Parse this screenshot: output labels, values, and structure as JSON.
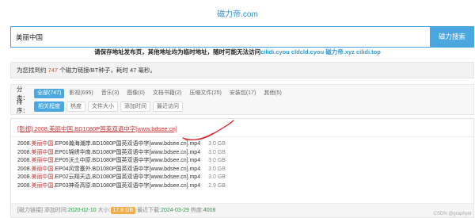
{
  "header": {
    "site_name": "磁力帝.com"
  },
  "search": {
    "value": "美丽中国",
    "button_label": "磁力搜索"
  },
  "notice": {
    "text": "请保存地址发布页，其他地址均为临时地址，随时可能无法访问",
    "mirrors": "cilidi.cyou cldcld.cyou 磁力帝.xyz cilidi.top"
  },
  "result_summary": {
    "prefix": "为您找到约",
    "count": "747",
    "suffix": "个磁力链接/BT种子，耗时 47 毫秒。"
  },
  "filters": {
    "category_label": "分类：",
    "categories": [
      {
        "label": "全部(747)",
        "active": true
      },
      {
        "label": "影视(695)",
        "active": false
      },
      {
        "label": "音乐(3)",
        "active": false
      },
      {
        "label": "图像(0)",
        "active": false
      },
      {
        "label": "文档书籍(2)",
        "active": false
      },
      {
        "label": "压缩文件(25)",
        "active": false
      },
      {
        "label": "安装包(17)",
        "active": false
      },
      {
        "label": "其他(5)",
        "active": false
      }
    ],
    "sort_label": "排序：",
    "sorts": [
      {
        "label": "相关程度",
        "active": true
      },
      {
        "label": "热度",
        "active": false
      },
      {
        "label": "文件大小",
        "active": false
      },
      {
        "label": "添加时间",
        "active": false
      },
      {
        "label": "最近访问",
        "active": false
      }
    ]
  },
  "result": {
    "title_prefix": "[影视] 2008.",
    "title_highlight": "美丽中国",
    "title_suffix": ".BD1080P国英双语中字[www.bdsee.cn]",
    "files": [
      {
        "prefix": "2008.",
        "highlight": "美丽中国",
        "suffix": ".EP06瀚海潮岸.BD1080P国英双语中字[www.bdsee.cn].mp4",
        "size": "3.0 GB"
      },
      {
        "prefix": "2008.",
        "highlight": "美丽中国",
        "suffix": ".EP01锦绣华南.BD1080P国英双语中字[www.bdsee.cn].mp4",
        "size": "3.0 GB"
      },
      {
        "prefix": "2008.",
        "highlight": "美丽中国",
        "suffix": ".EP05沃土中原.BD1080P国英双语中字[www.bdsee.cn].mp4",
        "size": "3.0 GB"
      },
      {
        "prefix": "2008.",
        "highlight": "美丽中国",
        "suffix": ".EP04风雪塞外.BD1080P国英双语中字[www.bdsee.cn].mp4",
        "size": "3.0 GB"
      },
      {
        "prefix": "2008.",
        "highlight": "美丽中国",
        "suffix": ".EP02云翔天边.BD1080P国英双语中字[www.bdsee.cn].mp4",
        "size": "3.0 GB"
      },
      {
        "prefix": "2008.",
        "highlight": "美丽中国",
        "suffix": ".EP03神奇高原.BD1080P国英双语中字[www.bdsee.cn].mp4",
        "size": "2.9 GB"
      }
    ],
    "footer": {
      "magnet_label": "[磁力链接]",
      "added_label": "添加时间:",
      "added_value": "2020-02-10",
      "size_label": "大小:",
      "size_value": "17.8 GB",
      "recent_label": "最近下载:",
      "recent_value": "2024-03-29",
      "heat_label": "热度:",
      "heat_value": "4008"
    }
  },
  "watermark": "CSDN @graphyer",
  "colors": {
    "accent": "#4aa7df",
    "highlight": "#c7373a",
    "count": "#e05a2b",
    "date": "#2a9d4a",
    "badge": "#f0ad4e"
  }
}
